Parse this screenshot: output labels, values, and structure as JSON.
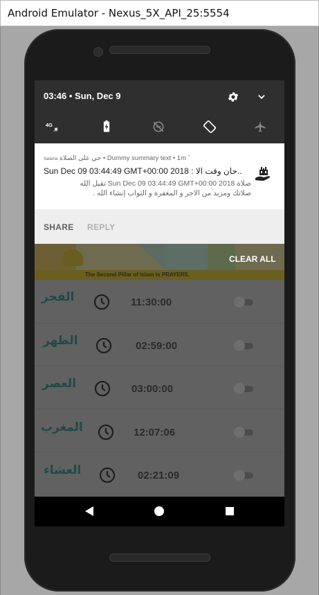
{
  "window": {
    "title": "Android Emulator - Nexus_5X_API_25:5554"
  },
  "status": {
    "time_date": "03:46 • Sun, Dec 9"
  },
  "quick_settings": {
    "icons": [
      "4g-signal-icon",
      "battery-saver-icon",
      "do-not-disturb-off-icon",
      "auto-rotate-icon",
      "airplane-mode-icon"
    ],
    "network_label": "4G"
  },
  "notification": {
    "app_name": "Salama",
    "header": "حي على الصلاة • Dummy summary text • 1m ˆ",
    "line1": "Sun Dec 09 03:44:49 GMT+00:00 2018  : حان وقت الا..",
    "line2": "صلاة Sun Dec 09 03:44:49 GMT+00:00 2018  تقبل الله",
    "line3": "صلاتك ومزيد من الاجر و المغفرة و الثواب إنشاء الله .",
    "actions": {
      "share": "SHARE",
      "reply": "REPLY"
    }
  },
  "banner": {
    "caption": "The Second Pillar of Islam is PRAYERS.",
    "clear_all": "CLEAR ALL"
  },
  "prayers": [
    {
      "name": "الفجر",
      "time": "11:30:00",
      "enabled": false
    },
    {
      "name": "الظهر",
      "time": "02:59:00",
      "enabled": false
    },
    {
      "name": "العصر",
      "time": "03:00:00",
      "enabled": false
    },
    {
      "name": "المغرب",
      "time": "12:07:06",
      "enabled": false
    },
    {
      "name": "العشاء",
      "time": "02:21:09",
      "enabled": false
    }
  ],
  "colors": {
    "accent_text": "#1f4a48",
    "scrim": "#616161",
    "notification_bg": "#ffffff"
  }
}
